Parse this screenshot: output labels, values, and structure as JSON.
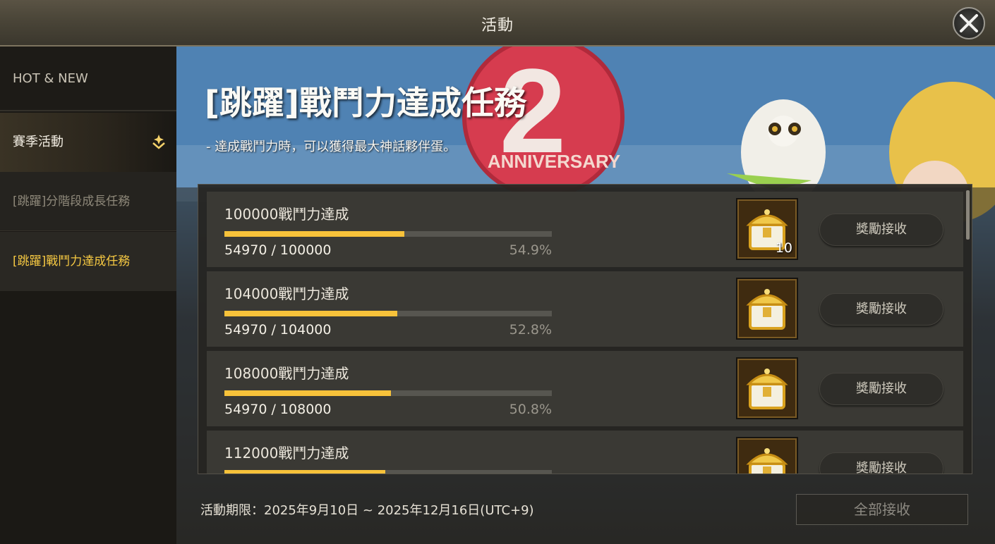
{
  "header": {
    "title": "活動"
  },
  "sidebar": {
    "items": [
      {
        "label": "HOT & NEW"
      },
      {
        "label": "賽季活動"
      },
      {
        "label": "[跳躍]分階段成長任務"
      },
      {
        "label": "[跳躍]戰鬥力達成任務"
      }
    ]
  },
  "banner": {
    "heading": "[跳躍]戰鬥力達成任務",
    "subtitle": "- 達成戰鬥力時，可以獲得最大神話夥伴蛋。",
    "art_text": "ANNIVERSARY",
    "art_number": "2"
  },
  "missions": [
    {
      "name": "100000戰鬥力達成",
      "progress_text": "54970 / 100000",
      "percent_text": "54.9%",
      "progress": 0.549,
      "reward_qty": "10",
      "claim_label": "獎勵接收"
    },
    {
      "name": "104000戰鬥力達成",
      "progress_text": "54970 / 104000",
      "percent_text": "52.8%",
      "progress": 0.528,
      "reward_qty": "",
      "claim_label": "獎勵接收"
    },
    {
      "name": "108000戰鬥力達成",
      "progress_text": "54970 / 108000",
      "percent_text": "50.8%",
      "progress": 0.508,
      "reward_qty": "",
      "claim_label": "獎勵接收"
    },
    {
      "name": "112000戰鬥力達成",
      "progress_text": "",
      "percent_text": "",
      "progress": 0.491,
      "reward_qty": "",
      "claim_label": "獎勵接收"
    }
  ],
  "footer": {
    "period": "活動期限：2025年9月10日 ~ 2025年12月16日(UTC+9)",
    "claim_all_label": "全部接收"
  },
  "colors": {
    "accent": "#f5c842",
    "progress": "#f7c23a"
  },
  "icons": {
    "close": "close-icon",
    "reward": "treasure-chest-icon",
    "expand": "sparkle-chevron-icon"
  }
}
